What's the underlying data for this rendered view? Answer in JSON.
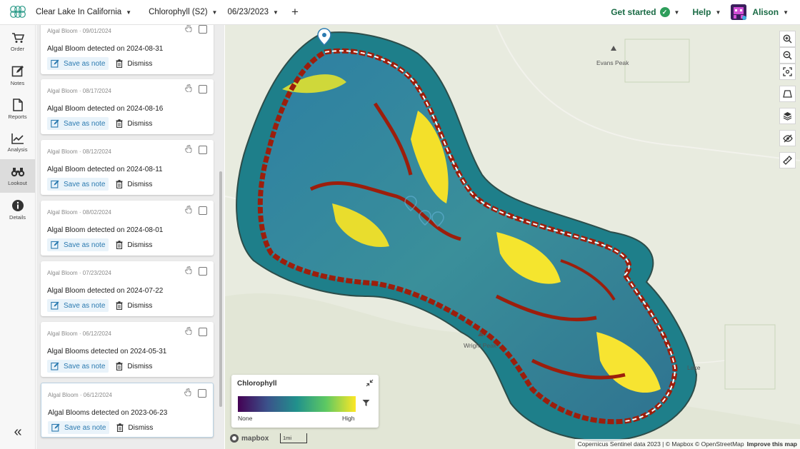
{
  "header": {
    "project": "Clear Lake In California",
    "layer": "Chlorophyll (S2)",
    "date": "06/23/2023",
    "add": "+",
    "get_started": "Get started",
    "help": "Help",
    "user": "Alison",
    "accent": "#1a6b45"
  },
  "nav": {
    "items": [
      {
        "label": "Order",
        "icon": "cart-icon"
      },
      {
        "label": "Notes",
        "icon": "edit-icon"
      },
      {
        "label": "Reports",
        "icon": "document-icon"
      },
      {
        "label": "Analysis",
        "icon": "chart-icon"
      },
      {
        "label": "Lookout",
        "icon": "binoculars-icon",
        "active": true
      },
      {
        "label": "Details",
        "icon": "info-icon"
      }
    ],
    "collapse": "«"
  },
  "alerts": [
    {
      "header": "Algal Bloom · 09/01/2024",
      "title": "Algal Bloom detected on 2024-08-31",
      "save": "Save as note",
      "dismiss": "Dismiss"
    },
    {
      "header": "Algal Bloom · 08/17/2024",
      "title": "Algal Bloom detected on 2024-08-16",
      "save": "Save as note",
      "dismiss": "Dismiss"
    },
    {
      "header": "Algal Bloom · 08/12/2024",
      "title": "Algal Bloom detected on 2024-08-11",
      "save": "Save as note",
      "dismiss": "Dismiss"
    },
    {
      "header": "Algal Bloom · 08/02/2024",
      "title": "Algal Bloom detected on 2024-08-01",
      "save": "Save as note",
      "dismiss": "Dismiss"
    },
    {
      "header": "Algal Bloom · 07/23/2024",
      "title": "Algal Bloom detected on 2024-07-22",
      "save": "Save as note",
      "dismiss": "Dismiss"
    },
    {
      "header": "Algal Bloom · 06/12/2024",
      "title": "Algal Blooms detected on 2024-05-31",
      "save": "Save as note",
      "dismiss": "Dismiss"
    },
    {
      "header": "Algal Bloom · 06/12/2024",
      "title": "Algal Blooms detected on 2023-06-23",
      "save": "Save as note",
      "dismiss": "Dismiss"
    }
  ],
  "map": {
    "places": [
      "Evans Peak",
      "Wright Peak",
      "Lake"
    ],
    "legend": {
      "title": "Chlorophyll",
      "low": "None",
      "high": "High"
    },
    "mapbox": "mapbox",
    "scale": "1mi",
    "attribution": "Copernicus Sentinel data 2023 | © Mapbox © OpenStreetMap",
    "improve": "Improve this map",
    "controls": [
      "zoom-in-icon",
      "zoom-out-icon",
      "fit-icon",
      "measure-icon",
      "layers-icon",
      "hide-icon",
      "ruler-icon"
    ]
  }
}
